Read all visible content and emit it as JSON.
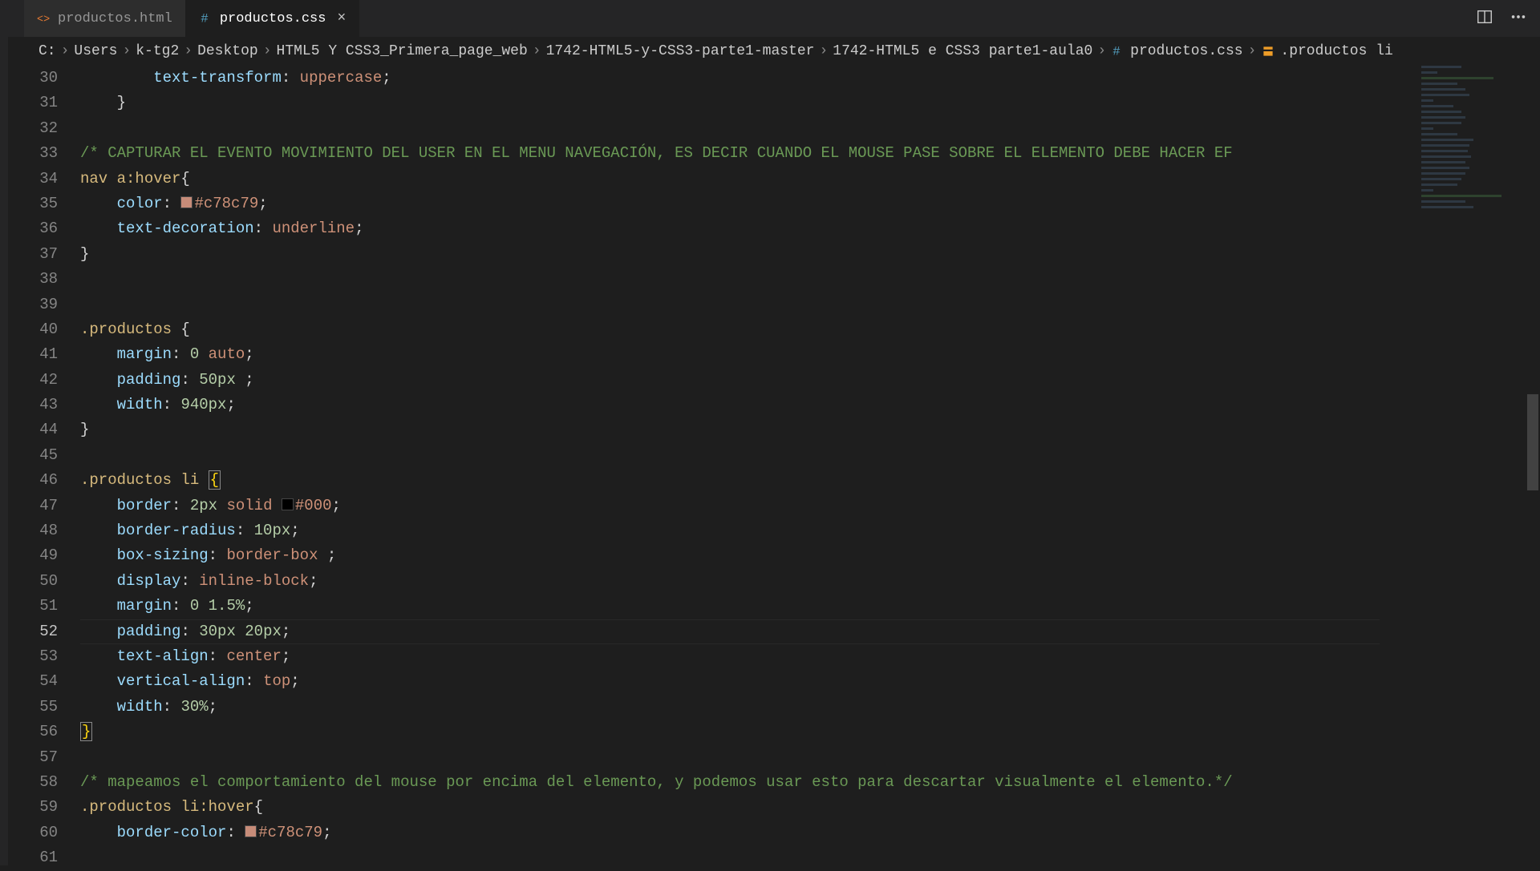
{
  "tabs": [
    {
      "label": "productos.html",
      "icon_color": "#e37933",
      "active": false
    },
    {
      "label": "productos.css",
      "icon_color": "#519aba",
      "active": true
    }
  ],
  "breadcrumb": {
    "parts": [
      "C:",
      "Users",
      "k-tg2",
      "Desktop",
      "HTML5 Y CSS3_Primera_page_web",
      "1742-HTML5-y-CSS3-parte1-master",
      "1742-HTML5 e CSS3 parte1-aula0"
    ],
    "file": "productos.css",
    "symbol": ".productos li"
  },
  "line_start": 30,
  "line_end": 61,
  "current_line": 52,
  "code_lines": [
    {
      "n": 30,
      "tokens": [
        [
          "        ",
          "p"
        ],
        [
          "text-transform",
          "prop"
        ],
        [
          ":",
          "p"
        ],
        [
          " ",
          "p"
        ],
        [
          "uppercase",
          "val"
        ],
        [
          ";",
          "p"
        ]
      ]
    },
    {
      "n": 31,
      "tokens": [
        [
          "    ",
          "p"
        ],
        [
          "}",
          "brace2"
        ]
      ]
    },
    {
      "n": 32,
      "tokens": []
    },
    {
      "n": 33,
      "tokens": [
        [
          "/* CAPTURAR EL EVENTO MOVIMIENTO DEL USER EN EL MENU NAVEGACIÓN, ES DECIR CUANDO EL MOUSE PASE SOBRE EL ELEMENTO DEBE HACER EF",
          "comment"
        ]
      ]
    },
    {
      "n": 34,
      "tokens": [
        [
          "nav a:hover",
          "sel"
        ],
        [
          "{",
          "brace2"
        ]
      ]
    },
    {
      "n": 35,
      "tokens": [
        [
          "    ",
          "p"
        ],
        [
          "color",
          "prop"
        ],
        [
          ":",
          "p"
        ],
        [
          " ",
          "p"
        ],
        [
          "SWATCH:#c78c79",
          ""
        ],
        [
          "#c78c79",
          "val"
        ],
        [
          ";",
          "p"
        ]
      ]
    },
    {
      "n": 36,
      "tokens": [
        [
          "    ",
          "p"
        ],
        [
          "text-decoration",
          "prop"
        ],
        [
          ":",
          "p"
        ],
        [
          " ",
          "p"
        ],
        [
          "underline",
          "val"
        ],
        [
          ";",
          "p"
        ]
      ]
    },
    {
      "n": 37,
      "tokens": [
        [
          "}",
          "brace2"
        ]
      ]
    },
    {
      "n": 38,
      "tokens": []
    },
    {
      "n": 39,
      "tokens": []
    },
    {
      "n": 40,
      "tokens": [
        [
          ".productos ",
          "sel"
        ],
        [
          "{",
          "brace2"
        ]
      ]
    },
    {
      "n": 41,
      "tokens": [
        [
          "    ",
          "p"
        ],
        [
          "margin",
          "prop"
        ],
        [
          ":",
          "p"
        ],
        [
          " ",
          "p"
        ],
        [
          "0",
          "num"
        ],
        [
          " ",
          "p"
        ],
        [
          "auto",
          "val"
        ],
        [
          ";",
          "p"
        ]
      ]
    },
    {
      "n": 42,
      "tokens": [
        [
          "    ",
          "p"
        ],
        [
          "padding",
          "prop"
        ],
        [
          ":",
          "p"
        ],
        [
          " ",
          "p"
        ],
        [
          "50px",
          "num"
        ],
        [
          " ;",
          "p"
        ]
      ]
    },
    {
      "n": 43,
      "tokens": [
        [
          "    ",
          "p"
        ],
        [
          "width",
          "prop"
        ],
        [
          ":",
          "p"
        ],
        [
          " ",
          "p"
        ],
        [
          "940px",
          "num"
        ],
        [
          ";",
          "p"
        ]
      ]
    },
    {
      "n": 44,
      "tokens": [
        [
          "}",
          "brace2"
        ]
      ]
    },
    {
      "n": 45,
      "tokens": []
    },
    {
      "n": 46,
      "tokens": [
        [
          ".productos li ",
          "sel"
        ],
        [
          "BRACEMATCH:{",
          ""
        ]
      ]
    },
    {
      "n": 47,
      "tokens": [
        [
          "    ",
          "p"
        ],
        [
          "border",
          "prop"
        ],
        [
          ":",
          "p"
        ],
        [
          " ",
          "p"
        ],
        [
          "2px",
          "num"
        ],
        [
          " ",
          "p"
        ],
        [
          "solid",
          "val"
        ],
        [
          " ",
          "p"
        ],
        [
          "SWATCH:#000000",
          ""
        ],
        [
          "#000",
          "val"
        ],
        [
          ";",
          "p"
        ]
      ]
    },
    {
      "n": 48,
      "tokens": [
        [
          "    ",
          "p"
        ],
        [
          "border-radius",
          "prop"
        ],
        [
          ":",
          "p"
        ],
        [
          " ",
          "p"
        ],
        [
          "10px",
          "num"
        ],
        [
          ";",
          "p"
        ]
      ]
    },
    {
      "n": 49,
      "tokens": [
        [
          "    ",
          "p"
        ],
        [
          "box-sizing",
          "prop"
        ],
        [
          ":",
          "p"
        ],
        [
          " ",
          "p"
        ],
        [
          "border-box",
          "val"
        ],
        [
          " ;",
          "p"
        ]
      ]
    },
    {
      "n": 50,
      "tokens": [
        [
          "    ",
          "p"
        ],
        [
          "display",
          "prop"
        ],
        [
          ":",
          "p"
        ],
        [
          " ",
          "p"
        ],
        [
          "inline-block",
          "val"
        ],
        [
          ";",
          "p"
        ]
      ]
    },
    {
      "n": 51,
      "tokens": [
        [
          "    ",
          "p"
        ],
        [
          "margin",
          "prop"
        ],
        [
          ":",
          "p"
        ],
        [
          " ",
          "p"
        ],
        [
          "0",
          "num"
        ],
        [
          " ",
          "p"
        ],
        [
          "1.5%",
          "num"
        ],
        [
          ";",
          "p"
        ]
      ]
    },
    {
      "n": 52,
      "tokens": [
        [
          "    ",
          "p"
        ],
        [
          "padding",
          "prop"
        ],
        [
          ":",
          "p"
        ],
        [
          " ",
          "p"
        ],
        [
          "30px",
          "num"
        ],
        [
          " ",
          "p"
        ],
        [
          "20px",
          "num"
        ],
        [
          ";",
          "p"
        ]
      ]
    },
    {
      "n": 53,
      "tokens": [
        [
          "    ",
          "p"
        ],
        [
          "text-align",
          "prop"
        ],
        [
          ":",
          "p"
        ],
        [
          " ",
          "p"
        ],
        [
          "center",
          "val"
        ],
        [
          ";",
          "p"
        ]
      ]
    },
    {
      "n": 54,
      "tokens": [
        [
          "    ",
          "p"
        ],
        [
          "vertical-align",
          "prop"
        ],
        [
          ":",
          "p"
        ],
        [
          " ",
          "p"
        ],
        [
          "top",
          "val"
        ],
        [
          ";",
          "p"
        ]
      ]
    },
    {
      "n": 55,
      "tokens": [
        [
          "    ",
          "p"
        ],
        [
          "width",
          "prop"
        ],
        [
          ":",
          "p"
        ],
        [
          " ",
          "p"
        ],
        [
          "30%",
          "num"
        ],
        [
          ";",
          "p"
        ]
      ]
    },
    {
      "n": 56,
      "tokens": [
        [
          "BRACEMATCH:}",
          ""
        ]
      ]
    },
    {
      "n": 57,
      "tokens": []
    },
    {
      "n": 58,
      "tokens": [
        [
          "/* mapeamos el comportamiento del mouse por encima del elemento, y podemos usar esto para descartar visualmente el elemento.*/",
          "comment"
        ]
      ]
    },
    {
      "n": 59,
      "tokens": [
        [
          ".productos li:hover",
          "sel"
        ],
        [
          "{",
          "brace2"
        ]
      ]
    },
    {
      "n": 60,
      "tokens": [
        [
          "    ",
          "p"
        ],
        [
          "border-color",
          "prop"
        ],
        [
          ":",
          "p"
        ],
        [
          " ",
          "p"
        ],
        [
          "SWATCH:#c78c79",
          ""
        ],
        [
          "#c78c79",
          "val"
        ],
        [
          ";",
          "p"
        ]
      ]
    },
    {
      "n": 61,
      "tokens": []
    }
  ],
  "colors": {
    "c78c79": "#c78c79",
    "black": "#000000"
  }
}
